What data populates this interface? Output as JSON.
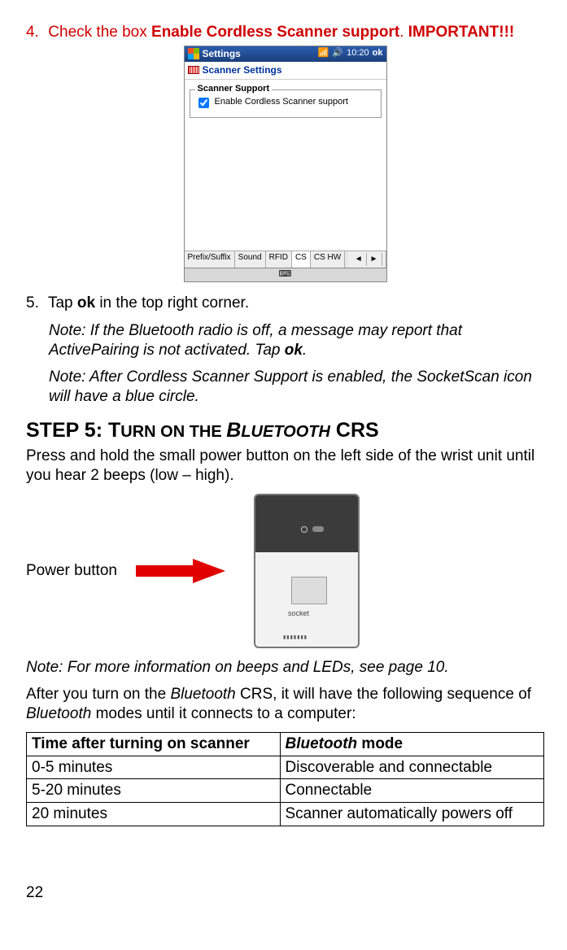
{
  "step4": {
    "num": "4.",
    "pre": "Check the box ",
    "bold": "Enable Cordless Scanner support",
    "post": ". ",
    "imp": "IMPORTANT!!!"
  },
  "shot": {
    "title": "Settings",
    "time": "10:20",
    "ok": "ok",
    "sub": "Scanner Settings",
    "group": "Scanner Support",
    "checkbox": "Enable Cordless Scanner support",
    "tabs": {
      "t1": "Prefix/Suffix",
      "t2": "Sound",
      "t3": "RFID",
      "t4": "CS",
      "t5": "CS HW"
    }
  },
  "step5": {
    "num": "5.",
    "text_a": "Tap ",
    "ok": "ok",
    "text_b": " in the top right corner."
  },
  "note1_a": "Note: If the Bluetooth radio is off, a message may report that ActivePairing is not activated. Tap ",
  "note1_ok": "ok",
  "note1_b": ".",
  "note2": "Note: After Cordless Scanner Support is enabled, the SocketScan icon will have a blue circle.",
  "heading": {
    "a": "STEP 5: T",
    "b": "URN ON THE ",
    "c": "B",
    "d": "LUETOOTH",
    "e": " CRS"
  },
  "para1": "Press and hold the small power button on the left side of the wrist unit until you hear 2 beeps (low – high).",
  "power_label": "Power button",
  "device_brand": "socket",
  "note3": "Note: For more information on beeps and LEDs, see page 10.",
  "para2_a": "After you turn on the ",
  "para2_bt": "Bluetooth",
  "para2_b": " CRS, it will have the following sequence of ",
  "para2_bt2": "Bluetooth",
  "para2_c": " modes until it connects to a computer:",
  "table": {
    "h1": "Time after turning on scanner",
    "h2_i": "Bluetooth",
    "h2_r": " mode",
    "rows": [
      {
        "c1": "0-5 minutes",
        "c2": "Discoverable and connectable"
      },
      {
        "c1": "5-20 minutes",
        "c2": "Connectable"
      },
      {
        "c1": "20 minutes",
        "c2": "Scanner automatically powers off"
      }
    ]
  },
  "page": "22"
}
